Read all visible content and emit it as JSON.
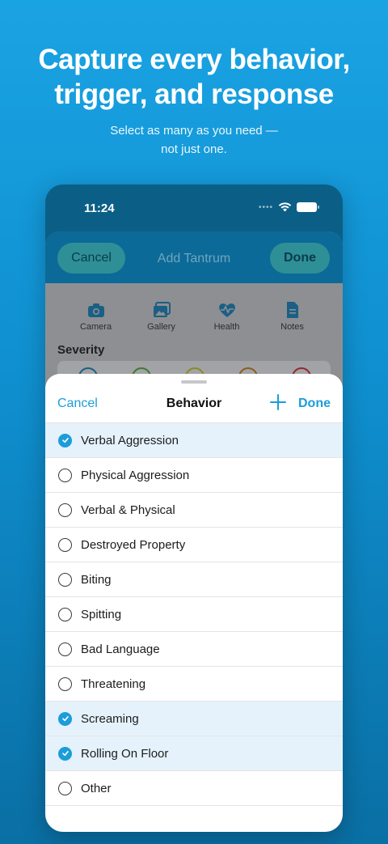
{
  "marketing": {
    "headline_line1": "Capture every behavior,",
    "headline_line2": "trigger, and response",
    "sub_line1": "Select as many as you need —",
    "sub_line2": "not just one."
  },
  "status_bar": {
    "time": "11:24"
  },
  "background_screen": {
    "cancel_label": "Cancel",
    "title": "Add Tantrum",
    "done_label": "Done",
    "attachments": [
      {
        "label": "Camera",
        "icon": "camera-icon"
      },
      {
        "label": "Gallery",
        "icon": "gallery-icon"
      },
      {
        "label": "Health",
        "icon": "health-icon"
      },
      {
        "label": "Notes",
        "icon": "notes-icon"
      }
    ],
    "severity_label": "Severity"
  },
  "sheet": {
    "cancel_label": "Cancel",
    "title": "Behavior",
    "done_label": "Done",
    "items": [
      {
        "label": "Verbal Aggression",
        "selected": true
      },
      {
        "label": "Physical Aggression",
        "selected": false
      },
      {
        "label": "Verbal & Physical",
        "selected": false
      },
      {
        "label": "Destroyed Property",
        "selected": false
      },
      {
        "label": "Biting",
        "selected": false
      },
      {
        "label": "Spitting",
        "selected": false
      },
      {
        "label": "Bad Language",
        "selected": false
      },
      {
        "label": "Threatening",
        "selected": false
      },
      {
        "label": "Screaming",
        "selected": true
      },
      {
        "label": "Rolling On Floor",
        "selected": true
      },
      {
        "label": "Other",
        "selected": false
      }
    ]
  },
  "colors": {
    "accent": "#1c9dd9",
    "selected_row": "#e5f2fb",
    "background_top": "#1aa3e3",
    "background_bottom": "#0a6fa4"
  }
}
